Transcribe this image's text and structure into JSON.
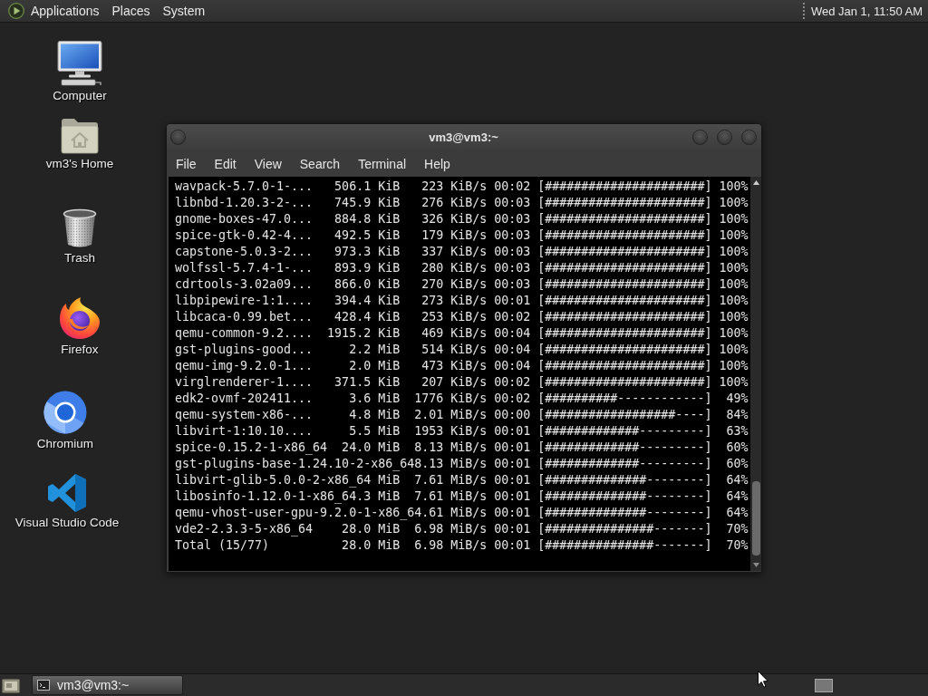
{
  "top_panel": {
    "menus": [
      "Applications",
      "Places",
      "System"
    ],
    "clock": "Wed Jan 1, 11:50 AM"
  },
  "desktop_icons": [
    {
      "label": "Computer",
      "kind": "computer"
    },
    {
      "label": "vm3's Home",
      "kind": "home"
    },
    {
      "label": "Trash",
      "kind": "trash"
    },
    {
      "label": "Firefox",
      "kind": "firefox"
    },
    {
      "label": "Chromium",
      "kind": "chromium"
    },
    {
      "label": "Visual Studio Code",
      "kind": "vscode"
    }
  ],
  "terminal_window": {
    "title": "vm3@vm3:~",
    "menu": [
      "File",
      "Edit",
      "View",
      "Search",
      "Terminal",
      "Help"
    ],
    "lines": [
      "wavpack-5.7.0-1-...   506.1 KiB   223 KiB/s 00:02 [######################] 100%",
      "libnbd-1.20.3-2-...   745.9 KiB   276 KiB/s 00:03 [######################] 100%",
      "gnome-boxes-47.0...   884.8 KiB   326 KiB/s 00:03 [######################] 100%",
      "spice-gtk-0.42-4...   492.5 KiB   179 KiB/s 00:03 [######################] 100%",
      "capstone-5.0.3-2...   973.3 KiB   337 KiB/s 00:03 [######################] 100%",
      "wolfssl-5.7.4-1-...   893.9 KiB   280 KiB/s 00:03 [######################] 100%",
      "cdrtools-3.02a09...   866.0 KiB   270 KiB/s 00:03 [######################] 100%",
      "libpipewire-1:1....   394.4 KiB   273 KiB/s 00:01 [######################] 100%",
      "libcaca-0.99.bet...   428.4 KiB   253 KiB/s 00:02 [######################] 100%",
      "qemu-common-9.2....  1915.2 KiB   469 KiB/s 00:04 [######################] 100%",
      "gst-plugins-good...     2.2 MiB   514 KiB/s 00:04 [######################] 100%",
      "qemu-img-9.2.0-1...     2.0 MiB   473 KiB/s 00:04 [######################] 100%",
      "virglrenderer-1....   371.5 KiB   207 KiB/s 00:02 [######################] 100%",
      "edk2-ovmf-202411...     3.6 MiB  1776 KiB/s 00:02 [##########------------]  49%",
      "qemu-system-x86-...     4.8 MiB  2.01 MiB/s 00:00 [##################----]  84%",
      "libvirt-1:10.10....     5.5 MiB  1953 KiB/s 00:01 [#############---------]  63%",
      "spice-0.15.2-1-x86_64  24.0 MiB  8.13 MiB/s 00:01 [#############---------]  60%",
      "gst-plugins-base-1.24.10-2-x86_648.13 MiB/s 00:01 [#############---------]  60%",
      "libvirt-glib-5.0.0-2-x86_64 MiB  7.61 MiB/s 00:01 [##############--------]  64%",
      "libosinfo-1.12.0-1-x86_64.3 MiB  7.61 MiB/s 00:01 [##############--------]  64%",
      "qemu-vhost-user-gpu-9.2.0-1-x86_64.61 MiB/s 00:01 [##############--------]  64%",
      "vde2-2.3.3-5-x86_64    28.0 MiB  6.98 MiB/s 00:01 [###############-------]  70%",
      "Total (15/77)          28.0 MiB  6.98 MiB/s 00:01 [###############-------]  70%"
    ]
  },
  "taskbar": {
    "tasks": [
      {
        "label": "vm3@vm3:~",
        "selected": true
      }
    ]
  }
}
